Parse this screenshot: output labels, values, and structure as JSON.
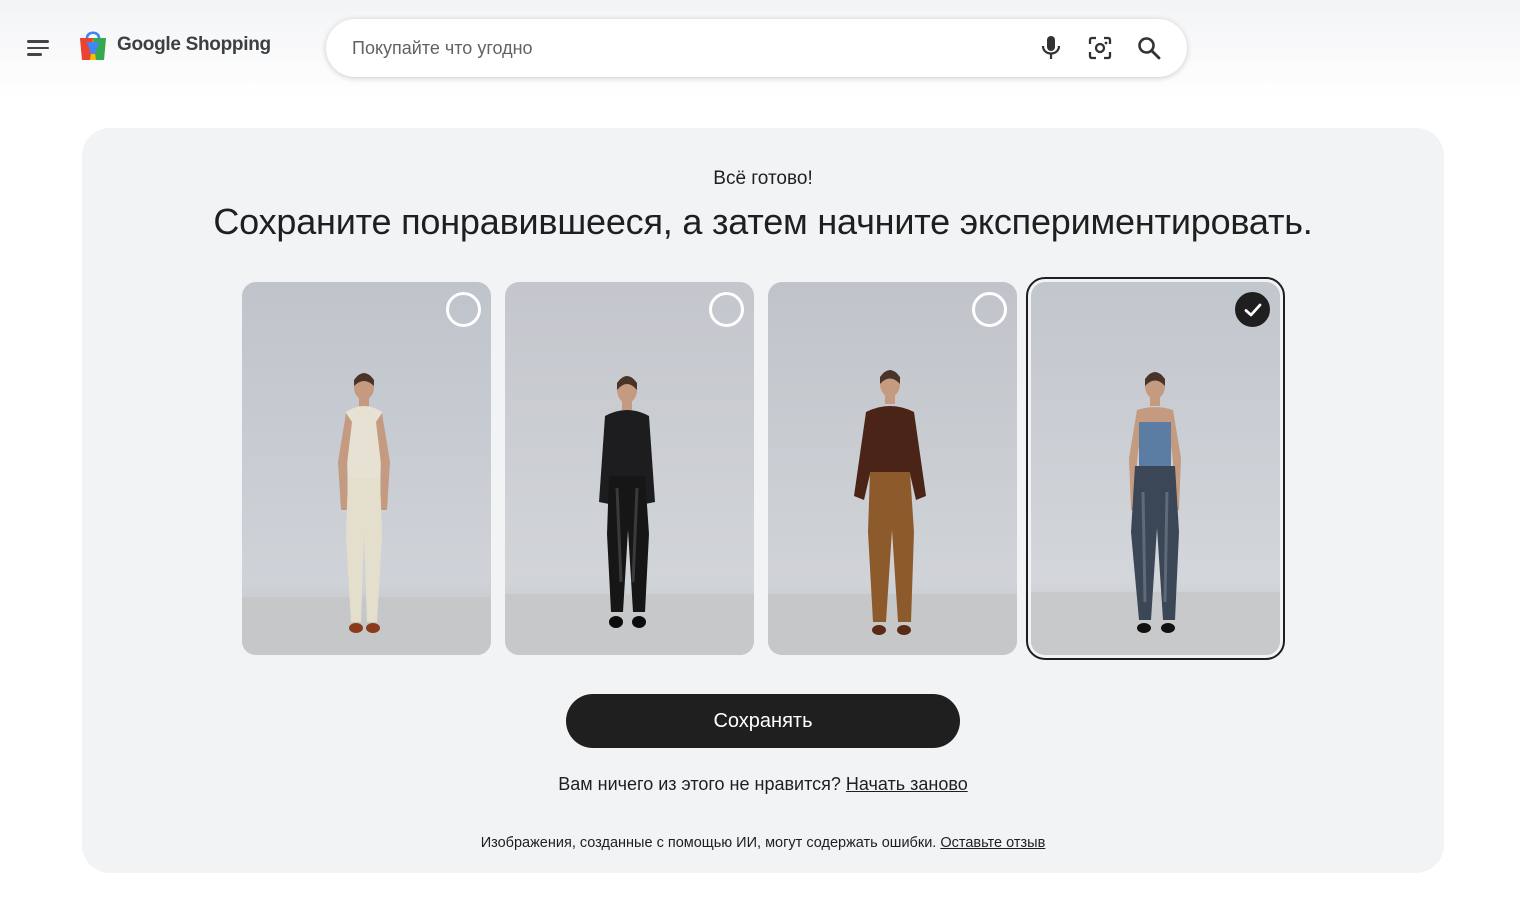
{
  "header": {
    "menu_icon": "hamburger-menu-icon",
    "logo_text": "Google Shopping",
    "logo_icon": "shopping-bag-icon",
    "search": {
      "placeholder": "Покупайте что угодно",
      "value": "",
      "icons": [
        "microphone-icon",
        "lens-camera-icon",
        "search-icon"
      ]
    }
  },
  "main": {
    "status_label": "Всё готово!",
    "headline": "Сохраните понравившееся, а затем начните экспериментировать.",
    "tiles": [
      {
        "outfit": "cream tank top, cream jeans, brown sandals",
        "selected": false
      },
      {
        "outfit": "black silk shirt, black leather pants",
        "selected": false
      },
      {
        "outfit": "brown sweater, tan trousers",
        "selected": false
      },
      {
        "outfit": "blue camisole, dark washed jeans",
        "selected": true
      }
    ],
    "save_label": "Сохранять",
    "retry_question": "Вам ничего из этого не нравится?",
    "retry_link": "Начать заново",
    "disclaimer_text": "Изображения, созданные с помощью ИИ, могут содержать ошибки.",
    "feedback_link": "Оставьте отзыв"
  },
  "colors": {
    "page_bg": "#ffffff",
    "card_bg": "#f2f3f5",
    "button_bg": "#1f1f1f",
    "text": "#1f1f1f",
    "logo_text": "#3c4043"
  }
}
